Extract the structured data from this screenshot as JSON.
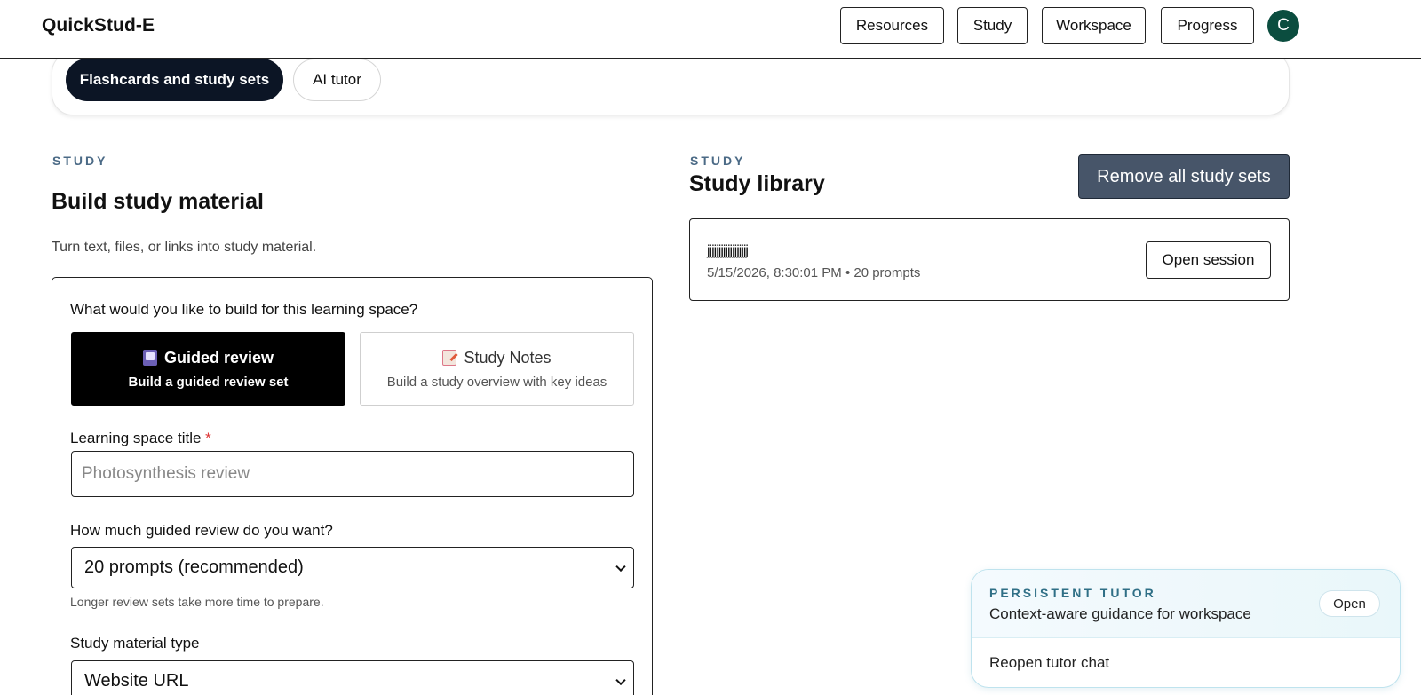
{
  "app": {
    "brand": "QuickStud-E"
  },
  "nav": {
    "items": [
      "Resources",
      "Study",
      "Workspace",
      "Progress"
    ],
    "avatar_initial": "C"
  },
  "modes": {
    "active": "Flashcards and study sets",
    "inactive": "AI tutor"
  },
  "build": {
    "kicker": "STUDY",
    "title": "Build study material",
    "subtitle": "Turn text, files, or links into study material.",
    "question": "What would you like to build for this learning space?",
    "options": [
      {
        "title": "Guided review",
        "desc": "Build a guided review set",
        "icon": "book-icon",
        "selected": true
      },
      {
        "title": "Study Notes",
        "desc": "Build a study overview with key ideas",
        "icon": "memo-icon",
        "selected": false
      }
    ],
    "title_label": "Learning space title",
    "required_mark": "*",
    "title_placeholder": "Photosynthesis review",
    "amount_label": "How much guided review do you want?",
    "amount_value": "20 prompts (recommended)",
    "amount_hint": "Longer review sets take more time to prepare.",
    "type_label": "Study material type",
    "type_value": "Website URL"
  },
  "library": {
    "kicker": "STUDY",
    "title": "Study library",
    "remove_all": "Remove all study sets",
    "items": [
      {
        "title": "jjjjjjjjjjjjjjjjjj",
        "meta": "5/15/2026, 8:30:01 PM • 20 prompts",
        "action": "Open session"
      }
    ]
  },
  "tutor": {
    "kicker": "PERSISTENT TUTOR",
    "desc": "Context-aware guidance for workspace",
    "open": "Open",
    "reopen": "Reopen tutor chat"
  },
  "colors": {
    "dark_pill": "#0c1525",
    "remove_button": "#475569",
    "avatar": "#0b4d3f",
    "kicker": "#4b6a86"
  }
}
